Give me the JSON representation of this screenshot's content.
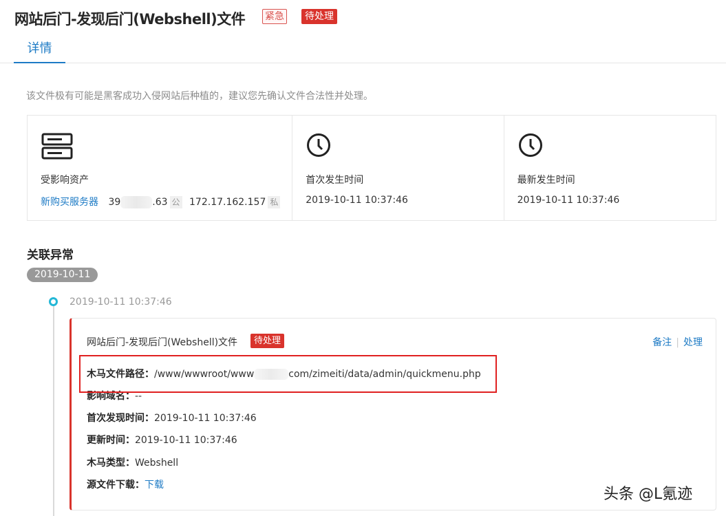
{
  "header": {
    "title": "网站后门-发现后门(Webshell)文件",
    "tag_urgent": "紧急",
    "tag_pending": "待处理",
    "tab_detail": "详情"
  },
  "notice": "该文件极有可能是黑客成功入侵网站后种植的，建议您先确认文件合法性并处理。",
  "stats": {
    "asset": {
      "icon": "server-icon",
      "label": "受影响资产",
      "server_link": "新购买服务器",
      "ip_public_prefix": "39",
      "ip_public_suffix": ".63",
      "ip_public_tag": "公",
      "ip_private": "172.17.162.157",
      "ip_private_tag": "私"
    },
    "first_seen": {
      "icon": "clock-icon",
      "label": "首次发生时间",
      "value": "2019-10-11 10:37:46"
    },
    "last_seen": {
      "icon": "clock-icon",
      "label": "最新发生时间",
      "value": "2019-10-11 10:37:46"
    }
  },
  "related": {
    "section_title": "关联异常",
    "date_pill": "2019-10-11",
    "timeline_time": "2019-10-11 10:37:46",
    "card": {
      "title": "网站后门-发现后门(Webshell)文件",
      "tag": "待处理",
      "action_note": "备注",
      "action_handle": "处理",
      "fields": {
        "path_key": "木马文件路径：",
        "path_prefix": "/www/wwwroot/www",
        "path_suffix": "com/zimeiti/data/admin/quickmenu.php",
        "domain_key": "影响域名：",
        "domain_value": "--",
        "first_key": "首次发现时间：",
        "first_value": "2019-10-11 10:37:46",
        "update_key": "更新时间：",
        "update_value": "2019-10-11 10:37:46",
        "type_key": "木马类型：",
        "type_value": "Webshell",
        "download_key": "源文件下载：",
        "download_value": "下载"
      }
    }
  },
  "watermark": "头条 @L氪迹",
  "colors": {
    "accent_blue": "#1e7bc5",
    "danger_red": "#d9332c",
    "timeline_cyan": "#23b7d6"
  }
}
